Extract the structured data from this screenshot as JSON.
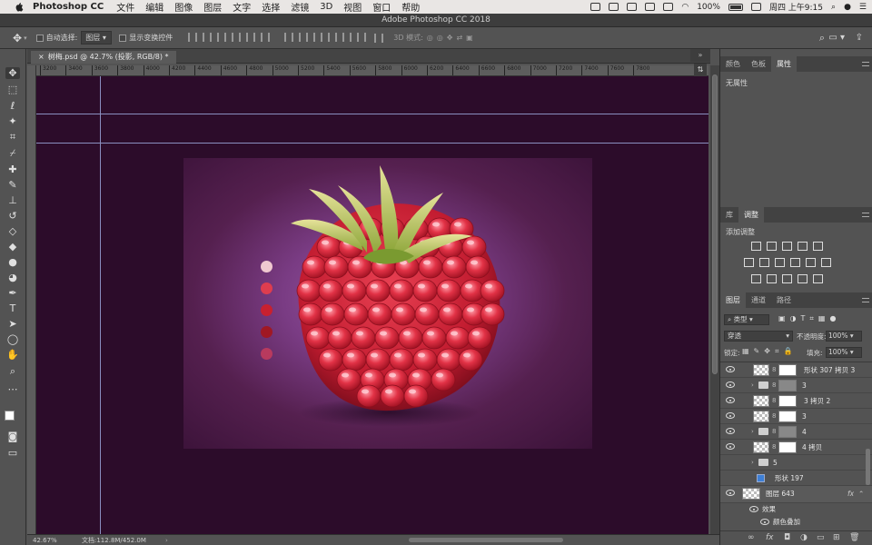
{
  "menubar": {
    "app_name": "Photoshop CC",
    "items": [
      "文件",
      "编辑",
      "图像",
      "图层",
      "文字",
      "选择",
      "滤镜",
      "3D",
      "视图",
      "窗口",
      "帮助"
    ],
    "battery": "100%",
    "clock": "周四 上午9:15"
  },
  "window_title": "Adobe Photoshop CC 2018",
  "options": {
    "auto_select_label": "自动选择:",
    "auto_select_value": "图层",
    "show_transform_label": "显示变换控件",
    "mode_3d_label": "3D 模式:"
  },
  "document": {
    "tab_label": "树梅.psd @ 42.7% (投影, RGB/8) *",
    "ruler_ticks": [
      "3200",
      "3400",
      "3600",
      "3800",
      "4000",
      "4200",
      "4400",
      "4600",
      "4800",
      "5000",
      "5200",
      "5400",
      "5600",
      "5800",
      "6000",
      "6200",
      "6400",
      "6600",
      "6800",
      "7000",
      "7200",
      "7400",
      "7600",
      "7800"
    ],
    "zoom": "42.67%",
    "doc_size": "文档:112.8M/452.0M"
  },
  "swatch_colors": [
    "#f0c8d0",
    "#de3d4f",
    "#c8202f",
    "#a01824",
    "#b83a5e"
  ],
  "panels": {
    "top_tabs": [
      "颜色",
      "色板",
      "属性"
    ],
    "properties_empty": "无属性",
    "mid_tabs": [
      "库",
      "调整"
    ],
    "add_adjustment": "添加调整",
    "layer_tabs": [
      "图层",
      "通道",
      "路径"
    ],
    "filter_kind": "类型",
    "blend_mode": "穿透",
    "opacity_label": "不透明度:",
    "opacity_value": "100%",
    "lock_label": "锁定:",
    "fill_label": "填充:",
    "fill_value": "100%",
    "layers": [
      {
        "name": "形状 307 拷贝 3",
        "kind": "shape"
      },
      {
        "name": "3",
        "kind": "group"
      },
      {
        "name": "3 拷贝 2",
        "kind": "shape"
      },
      {
        "name": "3",
        "kind": "shape"
      },
      {
        "name": "4",
        "kind": "group"
      },
      {
        "name": "4 拷贝",
        "kind": "shape"
      },
      {
        "name": "5",
        "kind": "group"
      },
      {
        "name": "形状 197",
        "kind": "shape"
      },
      {
        "name": "图层 643",
        "kind": "layer"
      },
      {
        "name": "效果",
        "kind": "effect"
      },
      {
        "name": "颜色叠加",
        "kind": "effect"
      }
    ]
  }
}
